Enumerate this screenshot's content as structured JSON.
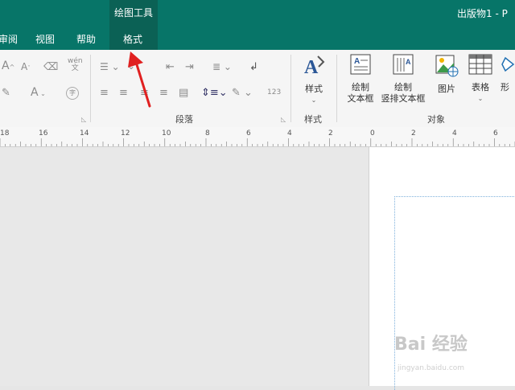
{
  "titlebar": {
    "context_tool_label": "绘图工具",
    "doc_title": "出版物1 - P"
  },
  "tabs": [
    {
      "label": "审阅",
      "active": false
    },
    {
      "label": "视图",
      "active": false
    },
    {
      "label": "帮助",
      "active": false
    },
    {
      "label": "格式",
      "active": true
    }
  ],
  "ribbon": {
    "font_group": {
      "phonetic_label": "wén\n文"
    },
    "paragraph_group": {
      "label": "段落",
      "number_label": "123"
    },
    "style_group": {
      "button_label": "样式",
      "label": "样式"
    },
    "object_group": {
      "label": "对象",
      "buttons": [
        {
          "label": "绘制\n文本框",
          "icon": "text-box-icon"
        },
        {
          "label": "绘制\n竖排文本框",
          "icon": "vertical-text-box-icon"
        },
        {
          "label": "图片",
          "icon": "picture-icon"
        },
        {
          "label": "表格",
          "icon": "table-icon"
        },
        {
          "label": "形",
          "icon": "shapes-icon"
        }
      ]
    }
  },
  "ruler": {
    "labels": [
      "18",
      "16",
      "14",
      "12",
      "10",
      "8",
      "6",
      "4",
      "2",
      "0",
      "2",
      "4",
      "6"
    ]
  },
  "watermark": {
    "text": "Bai 经验",
    "url": "jingyan.baidu.com"
  },
  "colors": {
    "titlebar": "#077568",
    "active_tab": "#0b6155",
    "arrow": "#e02020"
  }
}
